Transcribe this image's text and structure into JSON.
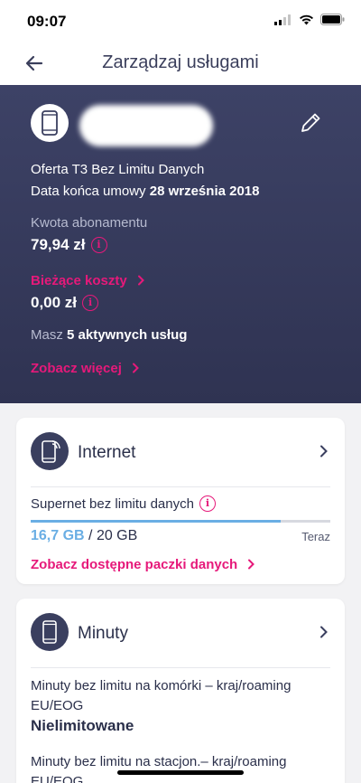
{
  "status_bar": {
    "time": "09:07"
  },
  "nav": {
    "title": "Zarządzaj usługami"
  },
  "account": {
    "offer_text": "Oferta T3 Bez Limitu Danych",
    "contract_end_label": "Data końca umowy",
    "contract_end_date": "28 września 2018",
    "subscription_label": "Kwota abonamentu",
    "subscription_amount": "79,94 zł",
    "current_costs_link": "Bieżące koszty",
    "current_costs_amount": "0,00 zł",
    "services_prefix": "Masz",
    "services_count": "5 aktywnych usług",
    "see_more_link": "Zobacz więcej"
  },
  "internet_card": {
    "title": "Internet",
    "plan_name": "Supernet bez limitu danych",
    "used": "16,7 GB",
    "total": "/ 20 GB",
    "usage_fraction": 0.835,
    "now_label": "Teraz",
    "packages_link": "Zobacz dostępne paczki danych"
  },
  "minutes_card": {
    "title": "Minuty",
    "item1_label": "Minuty bez limitu na komórki – kraj/roaming EU/EOG",
    "item1_value": "Nielimitowane",
    "item2_label": "Minuty bez limitu na stacjon.– kraj/roaming EU/EOG"
  },
  "colors": {
    "accent": "#e6197a",
    "hero_bg": "#3d4266",
    "usage_bar": "#6aaee4"
  },
  "icons": [
    "back-arrow-icon",
    "phone-icon",
    "pencil-icon",
    "info-icon",
    "chevron-right-icon",
    "phone-wifi-icon"
  ]
}
